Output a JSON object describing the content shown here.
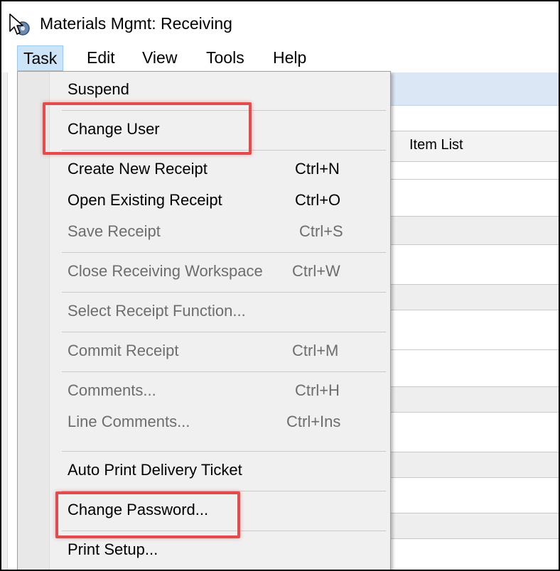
{
  "window": {
    "title": "Materials Mgmt: Receiving"
  },
  "menubar": {
    "items": [
      "Task",
      "Edit",
      "View",
      "Tools",
      "Help"
    ]
  },
  "background": {
    "item_list_header": "Item List"
  },
  "task_menu": {
    "items": [
      {
        "label": "Suspend",
        "shortcut": "",
        "enabled": true
      },
      {
        "label": "Change User",
        "shortcut": "",
        "enabled": true
      },
      {
        "label": "Create New Receipt",
        "shortcut": "Ctrl+N",
        "enabled": true
      },
      {
        "label": "Open Existing Receipt",
        "shortcut": "Ctrl+O",
        "enabled": true
      },
      {
        "label": "Save Receipt",
        "shortcut": "Ctrl+S",
        "enabled": false
      },
      {
        "label": "Close Receiving Workspace",
        "shortcut": "Ctrl+W",
        "enabled": false
      },
      {
        "label": "Select Receipt Function...",
        "shortcut": "",
        "enabled": false
      },
      {
        "label": "Commit Receipt",
        "shortcut": "Ctrl+M",
        "enabled": false
      },
      {
        "label": "Comments...",
        "shortcut": "Ctrl+H",
        "enabled": false
      },
      {
        "label": "Line Comments...",
        "shortcut": "Ctrl+Ins",
        "enabled": false
      },
      {
        "label": "Auto Print Delivery Ticket",
        "shortcut": "",
        "enabled": true
      },
      {
        "label": "Change Password...",
        "shortcut": "",
        "enabled": true
      },
      {
        "label": "Print Setup...",
        "shortcut": "",
        "enabled": true
      }
    ]
  },
  "annotations": {
    "highlighted_items": [
      "Change User",
      "Change Password..."
    ],
    "highlight_color": "#e24c4c"
  },
  "colors": {
    "menu_active_bg": "#cce4f7",
    "menu_bg": "#f0f0f0",
    "disabled_text": "#6d6d6d"
  }
}
